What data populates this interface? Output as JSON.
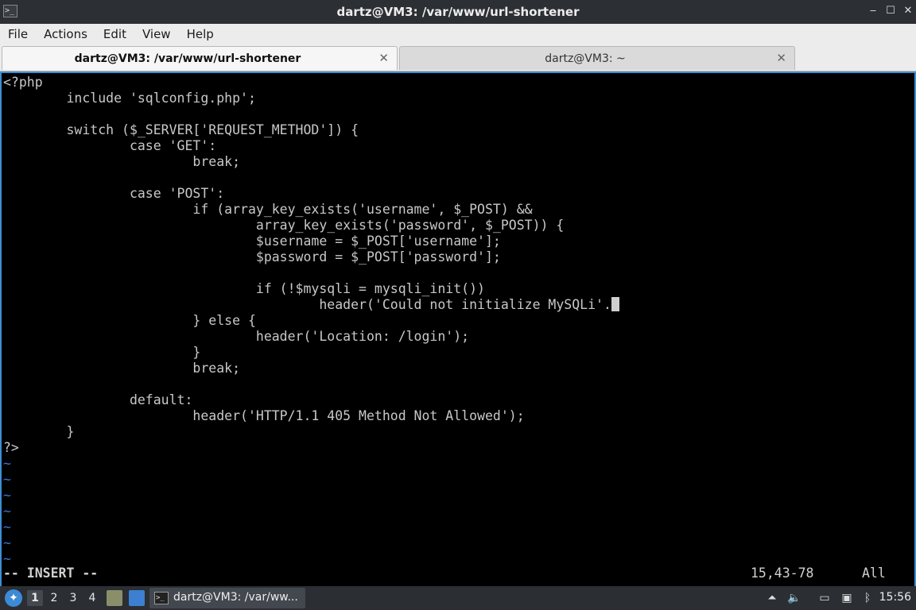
{
  "window": {
    "title": "dartz@VM3: /var/www/url-shortener",
    "app_icon": ">_",
    "buttons": {
      "minimize": "‒",
      "maximize": "☐",
      "close": "✕"
    }
  },
  "menubar": {
    "items": [
      "File",
      "Actions",
      "Edit",
      "View",
      "Help"
    ]
  },
  "tabs": [
    {
      "label": "dartz@VM3: /var/www/url-shortener",
      "close": "✕",
      "active": true
    },
    {
      "label": "dartz@VM3: ~",
      "close": "✕",
      "active": false
    }
  ],
  "editor": {
    "lines": [
      "<?php",
      "        include 'sqlconfig.php';",
      "",
      "        switch ($_SERVER['REQUEST_METHOD']) {",
      "                case 'GET':",
      "                        break;",
      "",
      "                case 'POST':",
      "                        if (array_key_exists('username', $_POST) &&",
      "                                array_key_exists('password', $_POST)) {",
      "                                $username = $_POST['username'];",
      "                                $password = $_POST['password'];",
      "",
      "                                if (!$mysqli = mysqli_init())",
      "                                        header('Could not initialize MySQLi'.",
      "                        } else {",
      "                                header('Location: /login');",
      "                        }",
      "                        break;",
      "",
      "                default:",
      "                        header('HTTP/1.1 405 Method Not Allowed');",
      "        }",
      "?>"
    ],
    "cursor_line": 14,
    "empty_marker": "~",
    "empty_lines": 7,
    "status": {
      "mode": "-- INSERT --",
      "position": "15,43-78",
      "scroll": "All"
    }
  },
  "taskbar": {
    "workspaces": [
      "1",
      "2",
      "3",
      "4"
    ],
    "active_workspace": "1",
    "task_label": "dartz@VM3: /var/ww...",
    "task_icon": ">_",
    "clock": "15:56"
  },
  "colors": {
    "accent": "#3c8fd4",
    "terminal_bg": "#000000",
    "terminal_fg": "#c8c8c8",
    "tilde": "#3c6fd4"
  },
  "icons": {
    "start": "start-menu-icon",
    "file_manager": "file-manager-icon",
    "desktop": "show-desktop-icon",
    "tray": [
      "upload-icon",
      "volume-icon",
      "clipboard-icon",
      "display-icon",
      "bluetooth-icon"
    ]
  }
}
